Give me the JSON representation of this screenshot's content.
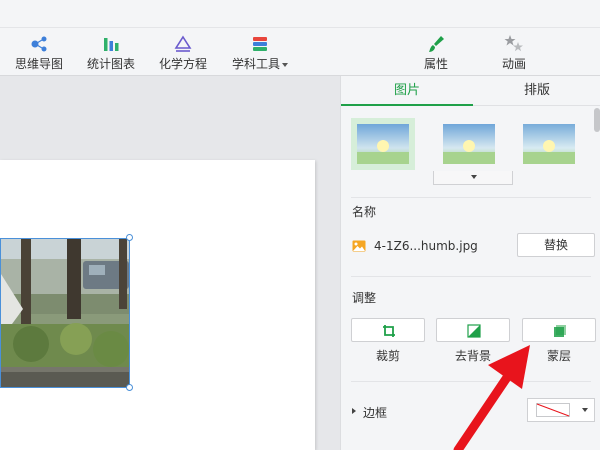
{
  "toolbar": {
    "items": [
      {
        "label": "思维导图",
        "icon": "mindmap-icon"
      },
      {
        "label": "统计图表",
        "icon": "chart-icon"
      },
      {
        "label": "化学方程",
        "icon": "chemistry-icon"
      },
      {
        "label": "学科工具",
        "icon": "subject-tools-icon"
      },
      {
        "label": "属性",
        "icon": "brush-icon"
      },
      {
        "label": "动画",
        "icon": "stars-icon"
      }
    ]
  },
  "panel": {
    "tabs": [
      {
        "label": "图片",
        "active": true
      },
      {
        "label": "排版",
        "active": false
      }
    ],
    "name_section": {
      "title": "名称",
      "file_name": "4-1Z6...humb.jpg",
      "replace_label": "替换"
    },
    "adjust_section": {
      "title": "调整",
      "buttons": [
        {
          "label": "裁剪",
          "icon": "crop-icon"
        },
        {
          "label": "去背景",
          "icon": "remove-background-icon"
        },
        {
          "label": "蒙层",
          "icon": "mask-layer-icon"
        }
      ]
    },
    "border_section": {
      "title": "边框"
    }
  },
  "colors": {
    "accent_green": "#1fa049",
    "selection_blue": "#4a90d9",
    "arrow_red": "#e8141c"
  }
}
